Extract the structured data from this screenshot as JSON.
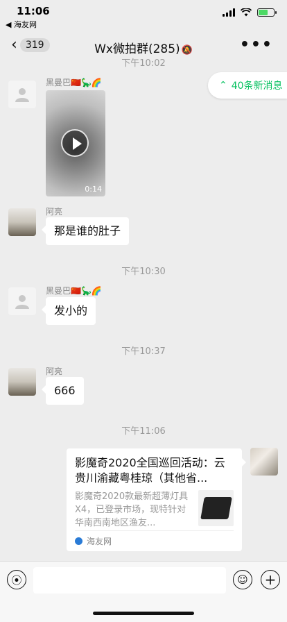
{
  "status": {
    "time": "11:06",
    "back_app": "◀ 海友网"
  },
  "nav": {
    "back_count": "319",
    "title": "Wx微拍群(285)"
  },
  "new_messages": "40条新消息",
  "timestamps": {
    "t0": "下午10:02",
    "t1": "下午10:30",
    "t2": "下午10:37",
    "t3": "下午11:06"
  },
  "messages": [
    {
      "sender": "黑曼巴🇨🇳🦕🌈",
      "type": "video",
      "duration": "0:14"
    },
    {
      "sender": "阿亮",
      "text": "那是谁的肚子"
    },
    {
      "sender": "黑曼巴🇨🇳🦕🌈",
      "text": "发小的"
    },
    {
      "sender": "阿亮",
      "text": "666"
    }
  ],
  "card": {
    "title": "影魔奇2020全国巡回活动：云贵川渝藏粤桂琼（其他省...",
    "desc": "影魔奇2020款最新超薄灯具X4，已登录市场，现特针对华南西南地区渔友...",
    "source": "海友网"
  },
  "colors": {
    "accent": "#07c160",
    "background": "#ededed"
  }
}
